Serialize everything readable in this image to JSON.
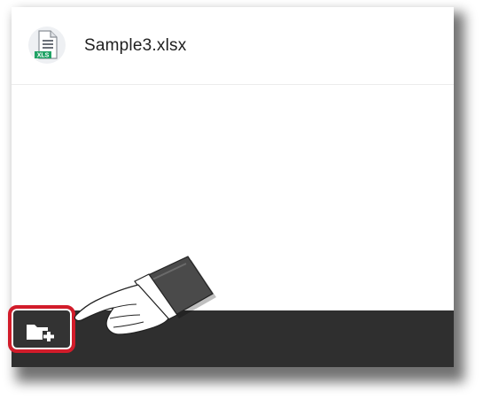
{
  "file_list": {
    "items": [
      {
        "name": "Sample3.xlsx",
        "icon": "xlsx-file-icon",
        "badge": "XLS"
      }
    ]
  },
  "toolbar": {
    "new_folder_icon": "new-folder-icon"
  },
  "colors": {
    "bar": "#2f2f2f",
    "highlight": "#d21c2a",
    "xls_green": "#21a366"
  }
}
